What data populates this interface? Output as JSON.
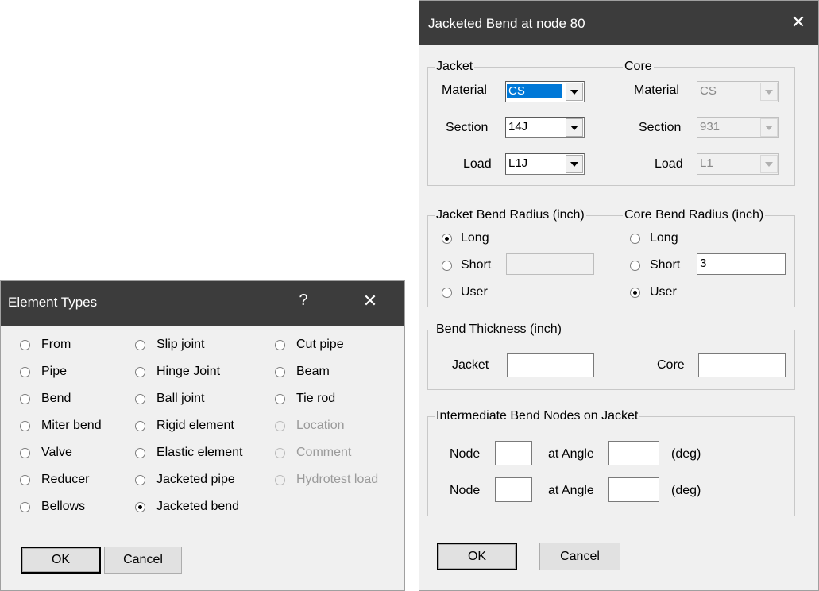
{
  "element_types": {
    "title": "Element Types",
    "help_label": "?",
    "close_label": "✕",
    "options": [
      {
        "label": "From",
        "state": "normal"
      },
      {
        "label": "Pipe",
        "state": "normal"
      },
      {
        "label": "Bend",
        "state": "normal"
      },
      {
        "label": "Miter bend",
        "state": "normal"
      },
      {
        "label": "Valve",
        "state": "normal"
      },
      {
        "label": "Reducer",
        "state": "normal"
      },
      {
        "label": "Bellows",
        "state": "normal"
      },
      {
        "label": "Slip joint",
        "state": "normal"
      },
      {
        "label": "Hinge Joint",
        "state": "normal"
      },
      {
        "label": "Ball joint",
        "state": "normal"
      },
      {
        "label": "Rigid element",
        "state": "normal"
      },
      {
        "label": "Elastic element",
        "state": "normal"
      },
      {
        "label": "Jacketed pipe",
        "state": "normal"
      },
      {
        "label": "Jacketed bend",
        "state": "checked"
      },
      {
        "label": "Cut pipe",
        "state": "normal"
      },
      {
        "label": "Beam",
        "state": "normal"
      },
      {
        "label": "Tie rod",
        "state": "normal"
      },
      {
        "label": "Location",
        "state": "disabled"
      },
      {
        "label": "Comment",
        "state": "disabled"
      },
      {
        "label": "Hydrotest load",
        "state": "disabled"
      }
    ],
    "ok_label": "OK",
    "cancel_label": "Cancel"
  },
  "jacketed_bend": {
    "title": "Jacketed Bend at node 80",
    "close_label": "✕",
    "jacket_group": {
      "caption": "Jacket",
      "material_label": "Material",
      "material_value": "CS",
      "section_label": "Section",
      "section_value": "14J",
      "load_label": "Load",
      "load_value": "L1J"
    },
    "core_group": {
      "caption": "Core",
      "material_label": "Material",
      "material_value": "CS",
      "section_label": "Section",
      "section_value": "931",
      "load_label": "Load",
      "load_value": "L1"
    },
    "jacket_radius": {
      "caption": "Jacket Bend Radius (inch)",
      "long_label": "Long",
      "short_label": "Short",
      "user_label": "User",
      "selected": "Long",
      "short_value": ""
    },
    "core_radius": {
      "caption": "Core Bend Radius (inch)",
      "long_label": "Long",
      "short_label": "Short",
      "user_label": "User",
      "selected": "User",
      "short_value": "3"
    },
    "thickness": {
      "caption": "Bend Thickness (inch)",
      "jacket_label": "Jacket",
      "jacket_value": "",
      "core_label": "Core",
      "core_value": ""
    },
    "intermediate": {
      "caption": "Intermediate Bend Nodes on Jacket",
      "rows": [
        {
          "node_label": "Node",
          "node_value": "",
          "angle_label": "at Angle",
          "angle_value": "",
          "unit": "(deg)"
        },
        {
          "node_label": "Node",
          "node_value": "",
          "angle_label": "at Angle",
          "angle_value": "",
          "unit": "(deg)"
        }
      ]
    },
    "ok_label": "OK",
    "cancel_label": "Cancel"
  }
}
